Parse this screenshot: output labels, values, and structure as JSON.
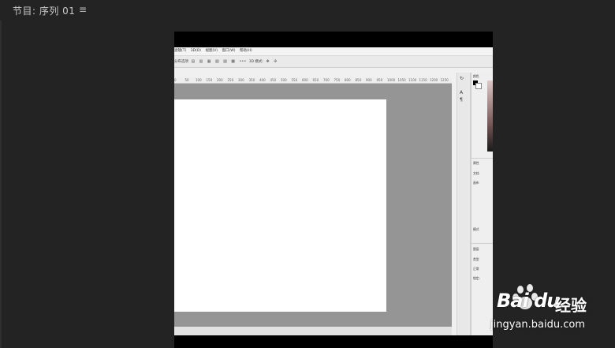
{
  "monitor": {
    "title": "节目: 序列 01",
    "menu_icon": "hamburger-icon"
  },
  "photoshop": {
    "menubar": [
      "滤镜(T)",
      "3D(D)",
      "视图(V)",
      "窗口(W)",
      "帮助(H)"
    ],
    "options_left": "分布选项",
    "options_mode": "3D 模式:",
    "ruler_ticks": [
      "0",
      "50",
      "100",
      "150",
      "200",
      "250",
      "300",
      "350",
      "400",
      "450",
      "500",
      "550",
      "600",
      "650",
      "700",
      "750",
      "800",
      "850",
      "900",
      "950",
      "1000",
      "1050",
      "1100",
      "1150",
      "1200",
      "1250"
    ],
    "panels": {
      "color_tab": "颜色",
      "color_tab2": "色板",
      "props_tab": "属性",
      "props_tab2": "调整",
      "props_doc": "文档",
      "props_canvas": "画布",
      "mode_label": "模式",
      "layers_tab": "图层",
      "layers_tab2": "通道",
      "layers_kind": "类型",
      "layers_normal": "正常",
      "layers_lock": "锁定:"
    }
  },
  "watermark": {
    "logo": "Bai du",
    "brand": "经验",
    "url": "jingyan.baidu.com"
  }
}
